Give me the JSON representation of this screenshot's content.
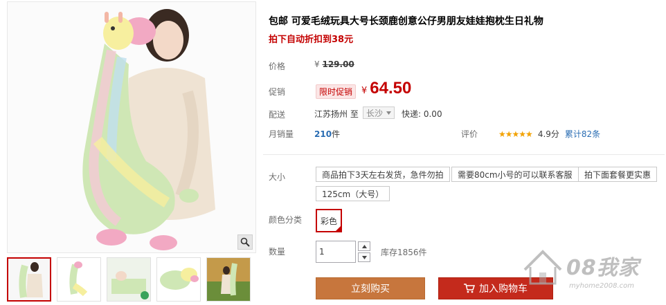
{
  "product": {
    "title": "包邮 可爱毛绒玩具大号长颈鹿创意公仔男朋友娃娃抱枕生日礼物",
    "subtitle": "拍下自动折扣到38元"
  },
  "price": {
    "label": "价格",
    "currency": "¥",
    "original": "129.00"
  },
  "promo": {
    "label": "促销",
    "tag": "限时促销",
    "currency": "¥",
    "price": "64.50"
  },
  "shipping": {
    "label": "配送",
    "from": "江苏扬州 至",
    "to": "长沙",
    "fee": "快递: 0.00"
  },
  "sales": {
    "label": "月销量",
    "count": "210",
    "unit": "件"
  },
  "rating": {
    "label": "评价",
    "stars": "★★★★★",
    "score": "4.9分",
    "count": "累计82条"
  },
  "size": {
    "label": "大小",
    "options": [
      "商品拍下3天左右发货，急件勿拍",
      "需要80cm小号的可以联系客服",
      "拍下面套餐更实惠",
      "125cm（大号）"
    ]
  },
  "color": {
    "label": "颜色分类",
    "selected": "彩色",
    "accent": "#c40000"
  },
  "quantity": {
    "label": "数量",
    "value": "1",
    "stock": "库存1856件"
  },
  "actions": {
    "buy": "立刻购买",
    "cart": "加入购物车",
    "buy_color": "#c7763d",
    "cart_color": "#c42a1c"
  },
  "watermark": {
    "brand": "08我家",
    "url": "myhome2008.com"
  },
  "icons": {
    "zoom": "magnifier-icon",
    "cart": "cart-icon",
    "dropdown": "chevron-down-icon",
    "qty_up": "triangle-up-icon",
    "qty_down": "triangle-down-icon"
  }
}
